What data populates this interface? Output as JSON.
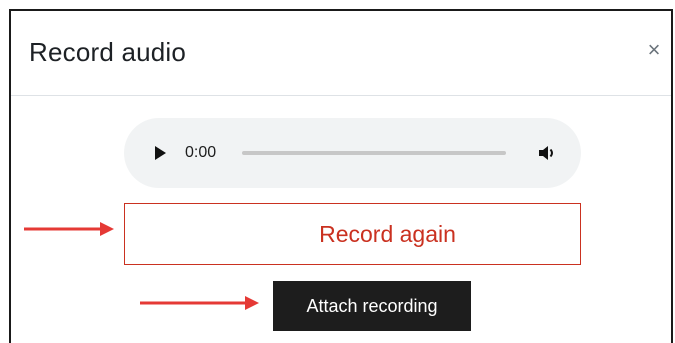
{
  "dialog": {
    "title": "Record audio",
    "close_icon": "close-icon",
    "close_glyph": "×"
  },
  "player": {
    "time": "0:00",
    "play_icon": "play-icon",
    "volume_icon": "volume-icon",
    "progress": 0
  },
  "actions": {
    "record_again_label": "Record again",
    "attach_label": "Attach recording"
  },
  "colors": {
    "danger": "#ca3120",
    "annotation_arrow": "#e53935",
    "attach_bg": "#1d1d1d",
    "player_bg": "#f1f3f4"
  }
}
